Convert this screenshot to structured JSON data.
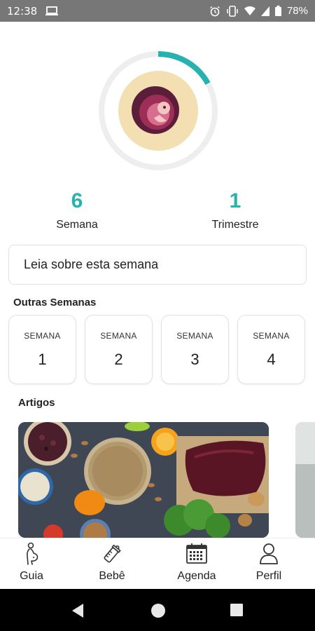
{
  "status_bar": {
    "time": "12:38",
    "battery": "78%",
    "icons": [
      "laptop-icon",
      "alarm-icon",
      "vibrate-icon",
      "wifi-icon",
      "signal-icon",
      "battery-icon"
    ]
  },
  "progress": {
    "fraction": 0.17,
    "track_color": "#eeeeee",
    "accent_color": "#26b3b0",
    "image_icon": "embryo-icon"
  },
  "stats": {
    "week": {
      "value": "6",
      "label": "Semana"
    },
    "trimester": {
      "value": "1",
      "label": "Trimestre"
    }
  },
  "read_card": {
    "label": "Leia sobre esta semana"
  },
  "other_weeks": {
    "title": "Outras Semanas",
    "items": [
      {
        "label": "SEMANA",
        "number": "1"
      },
      {
        "label": "SEMANA",
        "number": "2"
      },
      {
        "label": "SEMANA",
        "number": "3"
      },
      {
        "label": "SEMANA",
        "number": "4"
      }
    ]
  },
  "articles": {
    "title": "Artigos",
    "items": [
      {
        "image_icon": "healthy-food-image"
      },
      {
        "image_icon": "article-image-partial"
      }
    ]
  },
  "bottom_nav": {
    "items": [
      {
        "label": "Guia",
        "icon": "pregnant-icon"
      },
      {
        "label": "Bebê",
        "icon": "baby-bottle-icon"
      },
      {
        "label": "Agenda",
        "icon": "calendar-icon"
      },
      {
        "label": "Perfil",
        "icon": "user-icon"
      }
    ]
  },
  "system_nav": [
    "back-icon",
    "home-icon",
    "recents-icon"
  ]
}
